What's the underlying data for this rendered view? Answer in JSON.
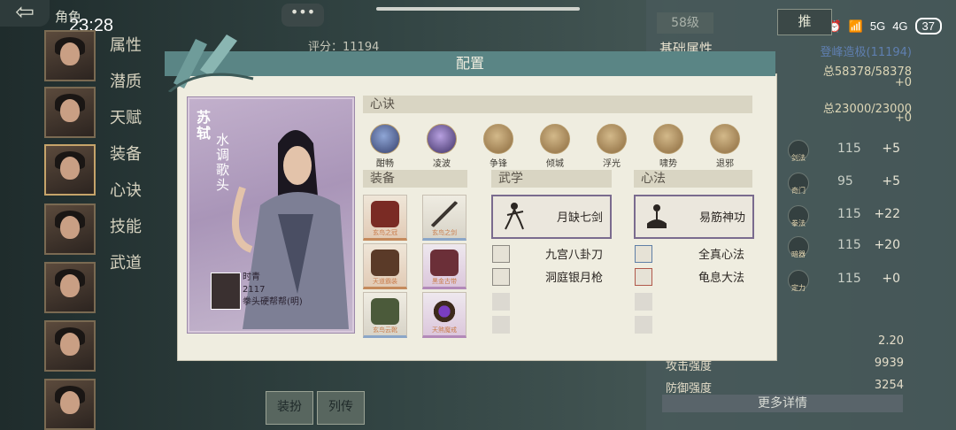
{
  "status": {
    "clock": "23:28",
    "signal1": "5G",
    "signal2": "4G",
    "battery": "37"
  },
  "top": {
    "role_title": "角色",
    "chat": "•••",
    "score_label": "评分：11194",
    "level": "58级",
    "recommend": "推"
  },
  "side_menu": [
    "属性",
    "潜质",
    "天赋",
    "装备",
    "心诀",
    "技能",
    "武道"
  ],
  "right_panel": {
    "base_attr_title": "基础属性",
    "base_attr_sub": "登峰造极(11194)",
    "hp": "总58378/58378",
    "hp_delta": "+0",
    "mp": "总23000/23000",
    "mp_delta": "+0",
    "stats": [
      {
        "label": "剑法",
        "value": "115",
        "delta": "+5"
      },
      {
        "label": "奇门",
        "value": "95",
        "delta": "+5"
      },
      {
        "label": "拳法",
        "value": "115",
        "delta": "+22"
      },
      {
        "label": "暗器",
        "value": "115",
        "delta": "+20"
      },
      {
        "label": "定力",
        "value": "115",
        "delta": "+0"
      }
    ],
    "bottom_stats": [
      {
        "label": "",
        "value": "2.20"
      },
      {
        "label": "攻击强度",
        "value": "9939"
      },
      {
        "label": "防御强度",
        "value": "3254"
      }
    ],
    "more_details": "更多详情"
  },
  "bottom_tabs": [
    "装扮",
    "列传"
  ],
  "modal": {
    "title": "配置",
    "hero": {
      "name": "苏轼",
      "alias": "水调歌头",
      "info_name": "时青",
      "info_num": "2117",
      "info_title": "拳头硬帮帮(明)"
    },
    "xinjue_title": "心诀",
    "xinjue": [
      "酣畅",
      "凌波",
      "争锋",
      "倾城",
      "浮光",
      "啸势",
      "退邪"
    ],
    "equip_title": "装备",
    "equips": [
      {
        "caption": "玄鸟之冠",
        "grade": "orange"
      },
      {
        "caption": "玄鸟之剑",
        "grade": "blue"
      },
      {
        "caption": "天道霸装",
        "grade": "orange"
      },
      {
        "caption": "黑金古带",
        "grade": "purple"
      },
      {
        "caption": "玄鸟云靴",
        "grade": "blue"
      },
      {
        "caption": "天煞魔戒",
        "grade": "purple"
      }
    ],
    "wuxue_title": "武学",
    "wuxue_main": "月缺七剑",
    "wuxue_subs": [
      "九宫八卦刀",
      "洞庭银月枪"
    ],
    "xinfa_title": "心法",
    "xinfa_main": "易筋神功",
    "xinfa_subs": [
      "全真心法",
      "龟息大法"
    ]
  },
  "colors": {
    "header": "#5a8585",
    "panel": "#efede0",
    "accent_purple": "#7a6b8e"
  }
}
